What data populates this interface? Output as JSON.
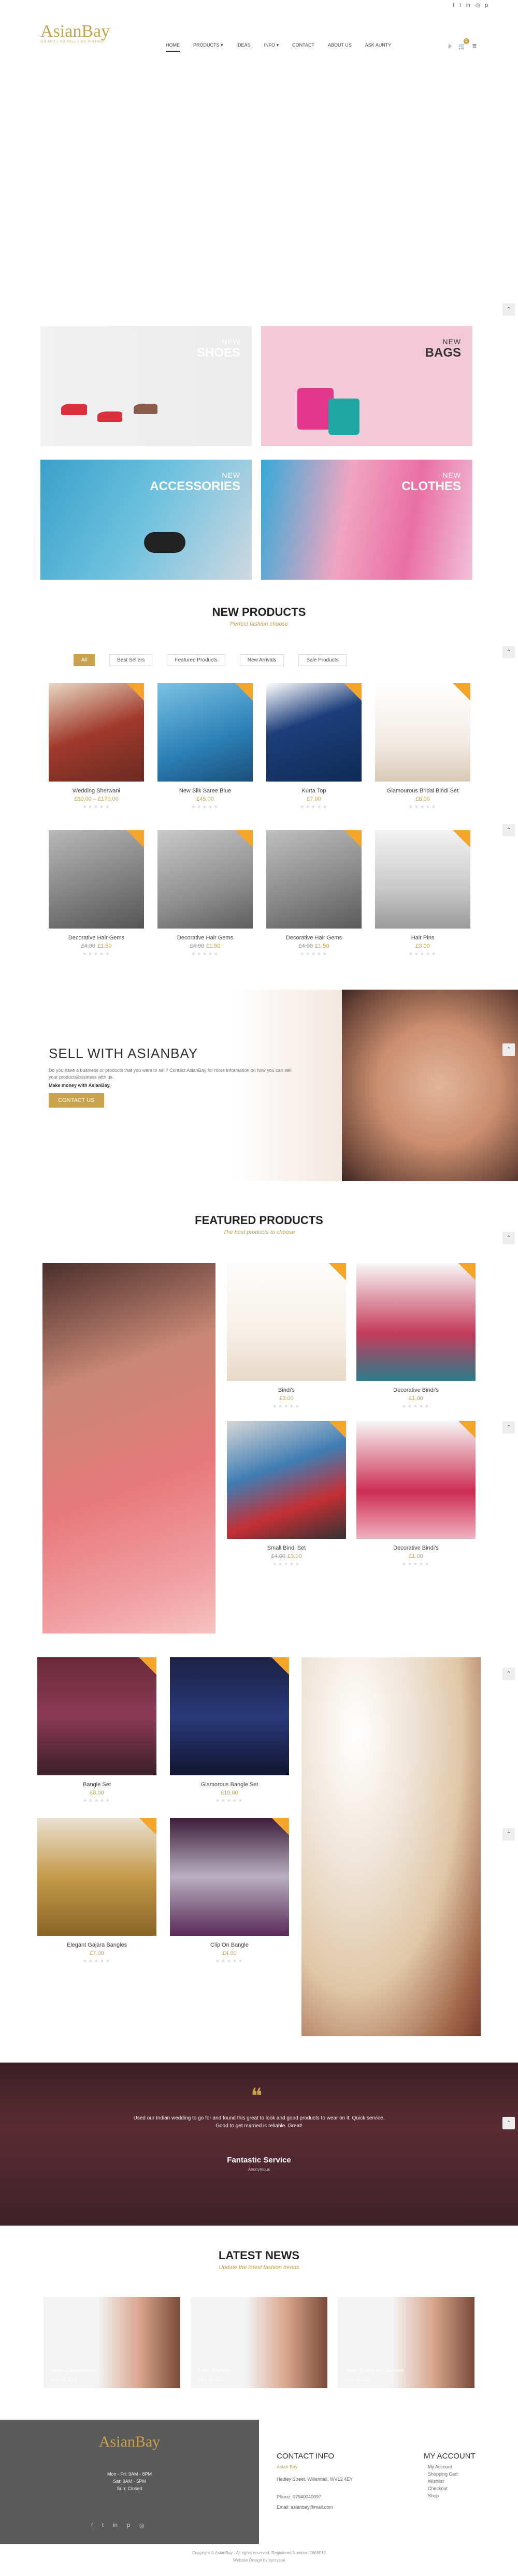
{
  "topbar": {
    "icons": [
      "facebook-icon",
      "twitter-icon",
      "linkedin-icon",
      "instagram-icon",
      "pinterest-icon"
    ],
    "glyphs": [
      "f",
      "t",
      "in",
      "◎",
      "p"
    ]
  },
  "header": {
    "logo": "AsianBay",
    "logo_tagline": "GO BUY | GO SELL | GO VINTAGE",
    "nav": [
      {
        "label": "Home",
        "active": true
      },
      {
        "label": "Products",
        "dropdown": true
      },
      {
        "label": "Ideas",
        "dropdown": false
      },
      {
        "label": "Info",
        "dropdown": true
      },
      {
        "label": "Contact",
        "dropdown": false
      },
      {
        "label": "About Us",
        "dropdown": false
      },
      {
        "label": "Ask Aunty",
        "dropdown": false
      }
    ],
    "cart_count": "0",
    "icons": {
      "search": "⌕",
      "cart": "🛒",
      "menu": "≡"
    }
  },
  "categories": [
    {
      "new": "NEW",
      "name": "SHOES"
    },
    {
      "new": "NEW",
      "name": "BAGS"
    },
    {
      "new": "NEW",
      "name": "ACCESSORIES"
    },
    {
      "new": "NEW",
      "name": "CLOTHES"
    }
  ],
  "new_products": {
    "title": "NEW PRODUCTS",
    "subtitle": "Perfect fashion choose",
    "filters": [
      {
        "label": "All",
        "active": true
      },
      {
        "label": "Best Sellers",
        "active": false
      },
      {
        "label": "Featured Products",
        "active": false
      },
      {
        "label": "New Arrivals",
        "active": false
      },
      {
        "label": "Sale Products",
        "active": false
      }
    ],
    "items": [
      {
        "name": "Wedding Sherwani",
        "old": "",
        "price": "£80.00 – £170.00"
      },
      {
        "name": "New Silk Saree Blue",
        "old": "",
        "price": "£45.00"
      },
      {
        "name": "Kurta Top",
        "old": "",
        "price": "£7.00"
      },
      {
        "name": "Glamourous Bridal Bindi Set",
        "old": "",
        "price": "£8.00"
      },
      {
        "name": "Decorative Hair Gems",
        "old": "£4.00",
        "price": "£1.50"
      },
      {
        "name": "Decorative Hair Gems",
        "old": "£4.00",
        "price": "£1.50"
      },
      {
        "name": "Decorative Hair Gems",
        "old": "£4.00",
        "price": "£1.50"
      },
      {
        "name": "Hair Pins",
        "old": "",
        "price": "£3.00"
      }
    ]
  },
  "sell": {
    "title": "SELL WITH ASIANBAY",
    "text": "Do you have a business or products that you want to sell? Contact AsianBay for more information on how you can sell your products/business with us.",
    "mm": "Make money with AsianBay.",
    "button": "CONTACT US"
  },
  "featured": {
    "title": "FEATURED PRODUCTS",
    "subtitle": "The best products to choose",
    "items": [
      {
        "name": "Bindi's",
        "old": "",
        "price": "£3.00"
      },
      {
        "name": "Decorative Bindi's",
        "old": "",
        "price": "£1.00"
      },
      {
        "name": "Small Bindi Set",
        "old": "£4.00",
        "price": "£3.00"
      },
      {
        "name": "Decorative Bindi's",
        "old": "",
        "price": "£1.00"
      },
      {
        "name": "Bangle Set",
        "old": "",
        "price": "£8.00"
      },
      {
        "name": "Glamorous Bangle Set",
        "old": "",
        "price": "£10.00"
      },
      {
        "name": "Elegant Gajara Bangles",
        "old": "",
        "price": "£7.00"
      },
      {
        "name": "Clip On Bangle",
        "old": "",
        "price": "£4.00"
      }
    ]
  },
  "testimonial": {
    "quote_mark": "❝",
    "text": "Used our Indian wedding to go for and found this great to look and good products to wear on it. Quick service. Good to get married is reliable. Great!",
    "title": "Fantastic Service",
    "author": "Anonymous"
  },
  "news": {
    "title": "LATEST NEWS",
    "subtitle": "Update the latest fashion trends",
    "items": [
      {
        "title": "Asian Centrepieces",
        "date": "June 15, 2017"
      },
      {
        "title": "Asian Fashion",
        "date": "June 15, 2017"
      },
      {
        "title": "Asian Brides and Grooms",
        "date": "June 15, 2017"
      }
    ]
  },
  "footer": {
    "logo": "AsianBay",
    "hours": [
      "Mon - Fri: 9AM - 8PM",
      "Sat: 9AM - 5PM",
      "Sun: Closed"
    ],
    "social": [
      "f",
      "t",
      "in",
      "p",
      "◎"
    ],
    "contact_title": "CONTACT INFO",
    "contact_sub": "Asian Bay",
    "address": "Hadley Street, Willenhall, WV12 4EY",
    "phone": "Phone: 07940040097",
    "email": "Email: asianbay@mail.com",
    "account_title": "MY ACCOUNT",
    "account_links": [
      "My Account",
      "Shopping Cart",
      "Wishlist",
      "Checkout",
      "Shop"
    ],
    "copyright": "Copyright © AsianBay - All rights reserved. Registered Number: 7868012",
    "credit": "Website Design by bycrystal"
  },
  "colors": {
    "accent": "#c9a24d",
    "sale": "#f4a52a"
  }
}
